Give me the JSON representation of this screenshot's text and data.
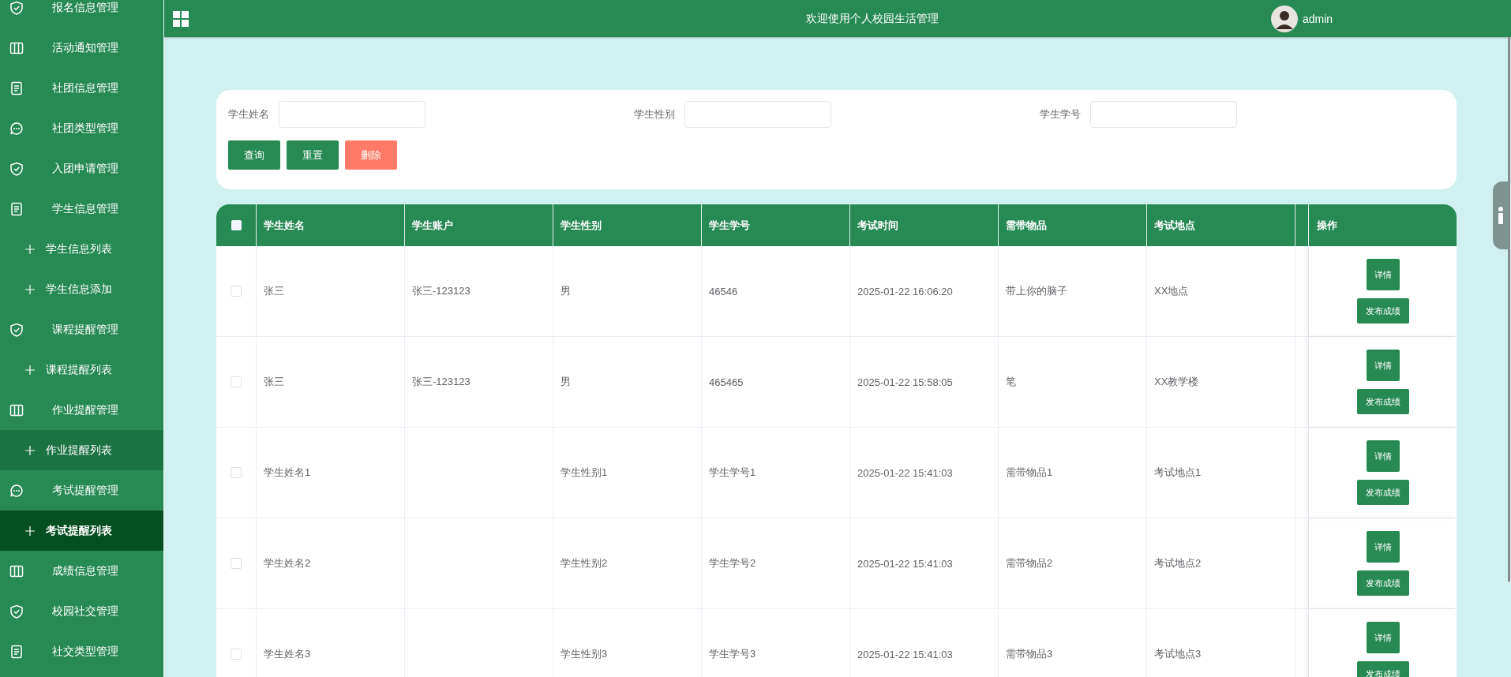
{
  "sidebar": {
    "items": [
      {
        "label": "报名信息管理"
      },
      {
        "label": "活动通知管理"
      },
      {
        "label": "社团信息管理"
      },
      {
        "label": "社团类型管理"
      },
      {
        "label": "入团申请管理"
      },
      {
        "label": "学生信息管理",
        "children": [
          {
            "label": "学生信息列表",
            "selected": false,
            "hovered": false
          },
          {
            "label": "学生信息添加",
            "selected": false,
            "hovered": false
          }
        ]
      },
      {
        "label": "课程提醒管理",
        "children": [
          {
            "label": "课程提醒列表",
            "selected": false,
            "hovered": false
          }
        ]
      },
      {
        "label": "作业提醒管理",
        "children": [
          {
            "label": "作业提醒列表",
            "selected": false,
            "hovered": true
          }
        ]
      },
      {
        "label": "考试提醒管理",
        "children": [
          {
            "label": "考试提醒列表",
            "selected": true,
            "hovered": false
          }
        ]
      },
      {
        "label": "成绩信息管理"
      },
      {
        "label": "校园社交管理"
      },
      {
        "label": "社交类型管理"
      }
    ]
  },
  "header": {
    "title": "欢迎使用个人校园生活管理",
    "username": "admin"
  },
  "filters": [
    {
      "label": "学生姓名"
    },
    {
      "label": "学生性别"
    },
    {
      "label": "学生学号"
    }
  ],
  "buttons": [
    {
      "label": "查询",
      "kind": "primary"
    },
    {
      "label": "重置",
      "kind": "primary"
    },
    {
      "label": "删除",
      "kind": "danger"
    }
  ],
  "table": {
    "all_checked": false,
    "columns": [
      "学生姓名",
      "学生账户",
      "学生性别",
      "学生学号",
      "考试时间",
      "需带物品",
      "考试地点"
    ],
    "actions_header": "操作",
    "rows": [
      {
        "checked": false,
        "cells": [
          "张三",
          "张三-123123",
          "男",
          "46546",
          "2025-01-22 16:06:20",
          "带上你的脑子",
          "XX地点"
        ],
        "actions": [
          "详情",
          "发布成绩"
        ]
      },
      {
        "checked": false,
        "cells": [
          "张三",
          "张三-123123",
          "男",
          "465465",
          "2025-01-22 15:58:05",
          "笔",
          "XX教学楼"
        ],
        "actions": [
          "详情",
          "发布成绩"
        ]
      },
      {
        "checked": false,
        "cells": [
          "学生姓名1",
          "",
          "学生性别1",
          "学生学号1",
          "2025-01-22 15:41:03",
          "需带物品1",
          "考试地点1"
        ],
        "actions": [
          "详情",
          "发布成绩"
        ]
      },
      {
        "checked": false,
        "cells": [
          "学生姓名2",
          "",
          "学生性别2",
          "学生学号2",
          "2025-01-22 15:41:03",
          "需带物品2",
          "考试地点2"
        ],
        "actions": [
          "详情",
          "发布成绩"
        ]
      },
      {
        "checked": false,
        "cells": [
          "学生姓名3",
          "",
          "学生性别3",
          "学生学号3",
          "2025-01-22 15:41:03",
          "需带物品3",
          "考试地点3"
        ],
        "actions": [
          "详情",
          "发布成绩"
        ]
      }
    ]
  }
}
